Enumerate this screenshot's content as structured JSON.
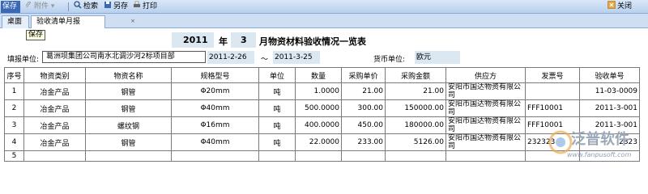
{
  "toolbar": {
    "save": "保存",
    "attach": "附件",
    "search": "检索",
    "save_as": "另存",
    "print": "打印",
    "close": "关闭"
  },
  "tabs": [
    {
      "label": "桌面"
    },
    {
      "label": "验收清单月报"
    }
  ],
  "tooltip": "保存",
  "title": {
    "year": "2011",
    "year_suffix": "年",
    "month": "3",
    "text": "月物资材料验收情况一览表"
  },
  "info": {
    "unit_label": "填报单位:",
    "unit_value": "葛洲坝集团公司南水北调沙河2标项目部",
    "date_from": "2011-2-26",
    "tilde": "～",
    "date_to": "2011-3-25",
    "currency_label": "货币单位:",
    "currency_value": "欧元"
  },
  "table": {
    "headers": [
      "序号",
      "物资类别",
      "物资名称",
      "规格型号",
      "单位",
      "数量",
      "采购单价",
      "采购金额",
      "供应方",
      "发票号",
      "验收单号"
    ],
    "rows": [
      [
        "1",
        "冶金产品",
        "钢管",
        "Φ20mm",
        "吨",
        "1.0000",
        "21.00",
        "21.00",
        "安阳市国达物资有限公司",
        "",
        "11-03-0009"
      ],
      [
        "2",
        "冶金产品",
        "钢管",
        "Φ40mm",
        "吨",
        "500.0000",
        "300.00",
        "150000.00",
        "安阳市国达物资有限公司",
        "FFF10001",
        "2011-3-001"
      ],
      [
        "3",
        "冶金产品",
        "螺纹钢",
        "Φ16mm",
        "吨",
        "400.0000",
        "450.00",
        "180000.00",
        "安阳市国达物资有限公司",
        "FFF10001",
        "2011-3-001"
      ],
      [
        "4",
        "冶金产品",
        "钢管",
        "Φ40mm",
        "吨",
        "22.0000",
        "233.00",
        "5126.00",
        "安阳市国达物资有限公司",
        "232323",
        "2323"
      ],
      [
        "5",
        "",
        "",
        "",
        "",
        "",
        "",
        "",
        "",
        "",
        ""
      ]
    ]
  },
  "watermark": {
    "text": "泛普软件",
    "url": "www.fanpusoft.com"
  }
}
